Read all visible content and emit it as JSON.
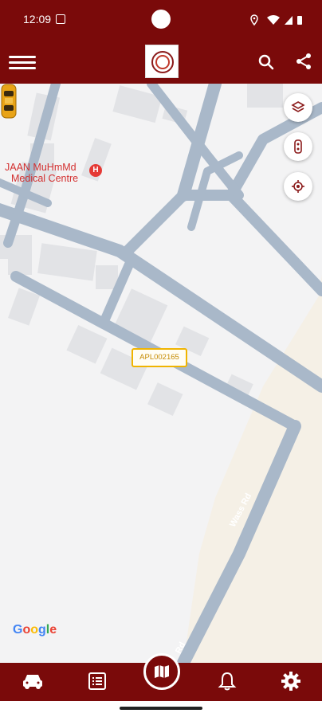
{
  "status_bar": {
    "time": "12:09"
  },
  "map": {
    "poi_name": "JAAN MuHmMd",
    "poi_sub": "Medical Centre",
    "hospital_marker": "H",
    "vehicle_id": "APL002165",
    "road_label_1": "Wass Rd",
    "road_label_2": "Rd",
    "attribution": "Google"
  },
  "icons": {
    "menu": "hamburger-icon",
    "search": "search-icon",
    "share": "share-icon",
    "layers": "layers-icon",
    "traffic": "traffic-light-icon",
    "locate": "my-location-icon",
    "car": "car-icon",
    "list": "list-icon",
    "map": "map-icon",
    "bell": "bell-icon",
    "settings": "gear-icon"
  },
  "colors": {
    "primary": "#7a0a0a",
    "accent": "#f0b400",
    "road": "#a9b8c9"
  }
}
